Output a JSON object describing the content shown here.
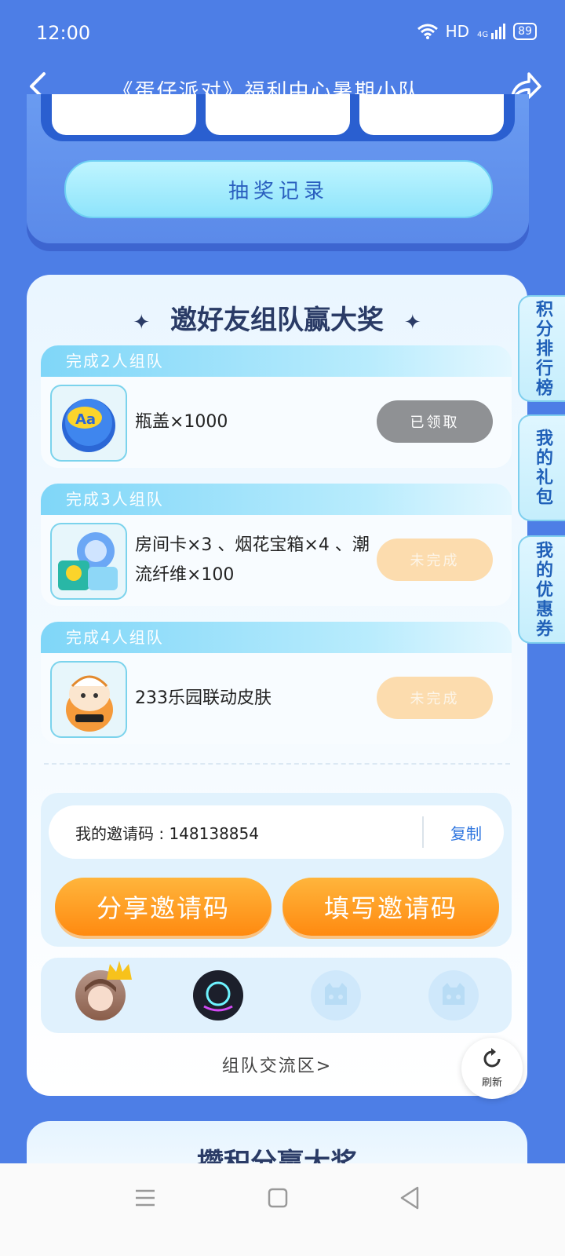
{
  "status_bar": {
    "time": "12:00",
    "network": "HD",
    "signal_label": "4G",
    "battery": "89"
  },
  "header": {
    "title": "《蛋仔派对》福利中心暑期小队 ..."
  },
  "lottery_record": "抽奖记录",
  "invite_section": {
    "title": "邀好友组队赢大奖",
    "tiers": [
      {
        "head": "完成2人组队",
        "reward": "瓶盖×1000",
        "status": "已领取"
      },
      {
        "head": "完成3人组队",
        "reward": "房间卡×3 、烟花宝箱×4 、潮流纤维×100",
        "status": "未完成"
      },
      {
        "head": "完成4人组队",
        "reward": "233乐园联动皮肤",
        "status": "未完成"
      }
    ],
    "invite_code_label": "我的邀请码 : 148138854",
    "copy": "复制",
    "share_code": "分享邀请码",
    "fill_code": "填写邀请码",
    "forum_link": "组队交流区>",
    "refresh": "刷新"
  },
  "side_tabs": [
    "积分排行榜",
    "我的礼包",
    "我的优惠券"
  ],
  "next_section_title": "攒积分赢大奖"
}
